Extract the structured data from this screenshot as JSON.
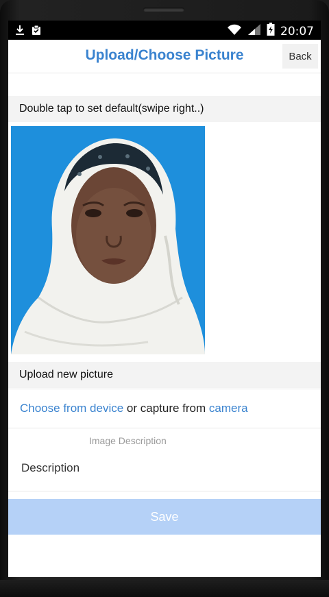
{
  "status_bar": {
    "time": "20:07",
    "left_icons": [
      "download-icon",
      "clipboard-icon"
    ],
    "right_icons": [
      "wifi-icon",
      "signal-icon",
      "battery-icon"
    ]
  },
  "header": {
    "title": "Upload/Choose Picture",
    "back_label": "Back"
  },
  "gallery": {
    "instruction": "Double tap to set default(swipe right..)",
    "photo_background": "#1e8fdc"
  },
  "upload": {
    "heading": "Upload new picture",
    "choose_link": "Choose from device",
    "middle_text": " or capture from ",
    "camera_link": "camera"
  },
  "description": {
    "label": "Image Description",
    "placeholder": "Description"
  },
  "save_label": "Save",
  "colors": {
    "accent": "#3a83cf",
    "save_disabled": "#b5d1f7",
    "section_bg": "#f3f3f3"
  }
}
